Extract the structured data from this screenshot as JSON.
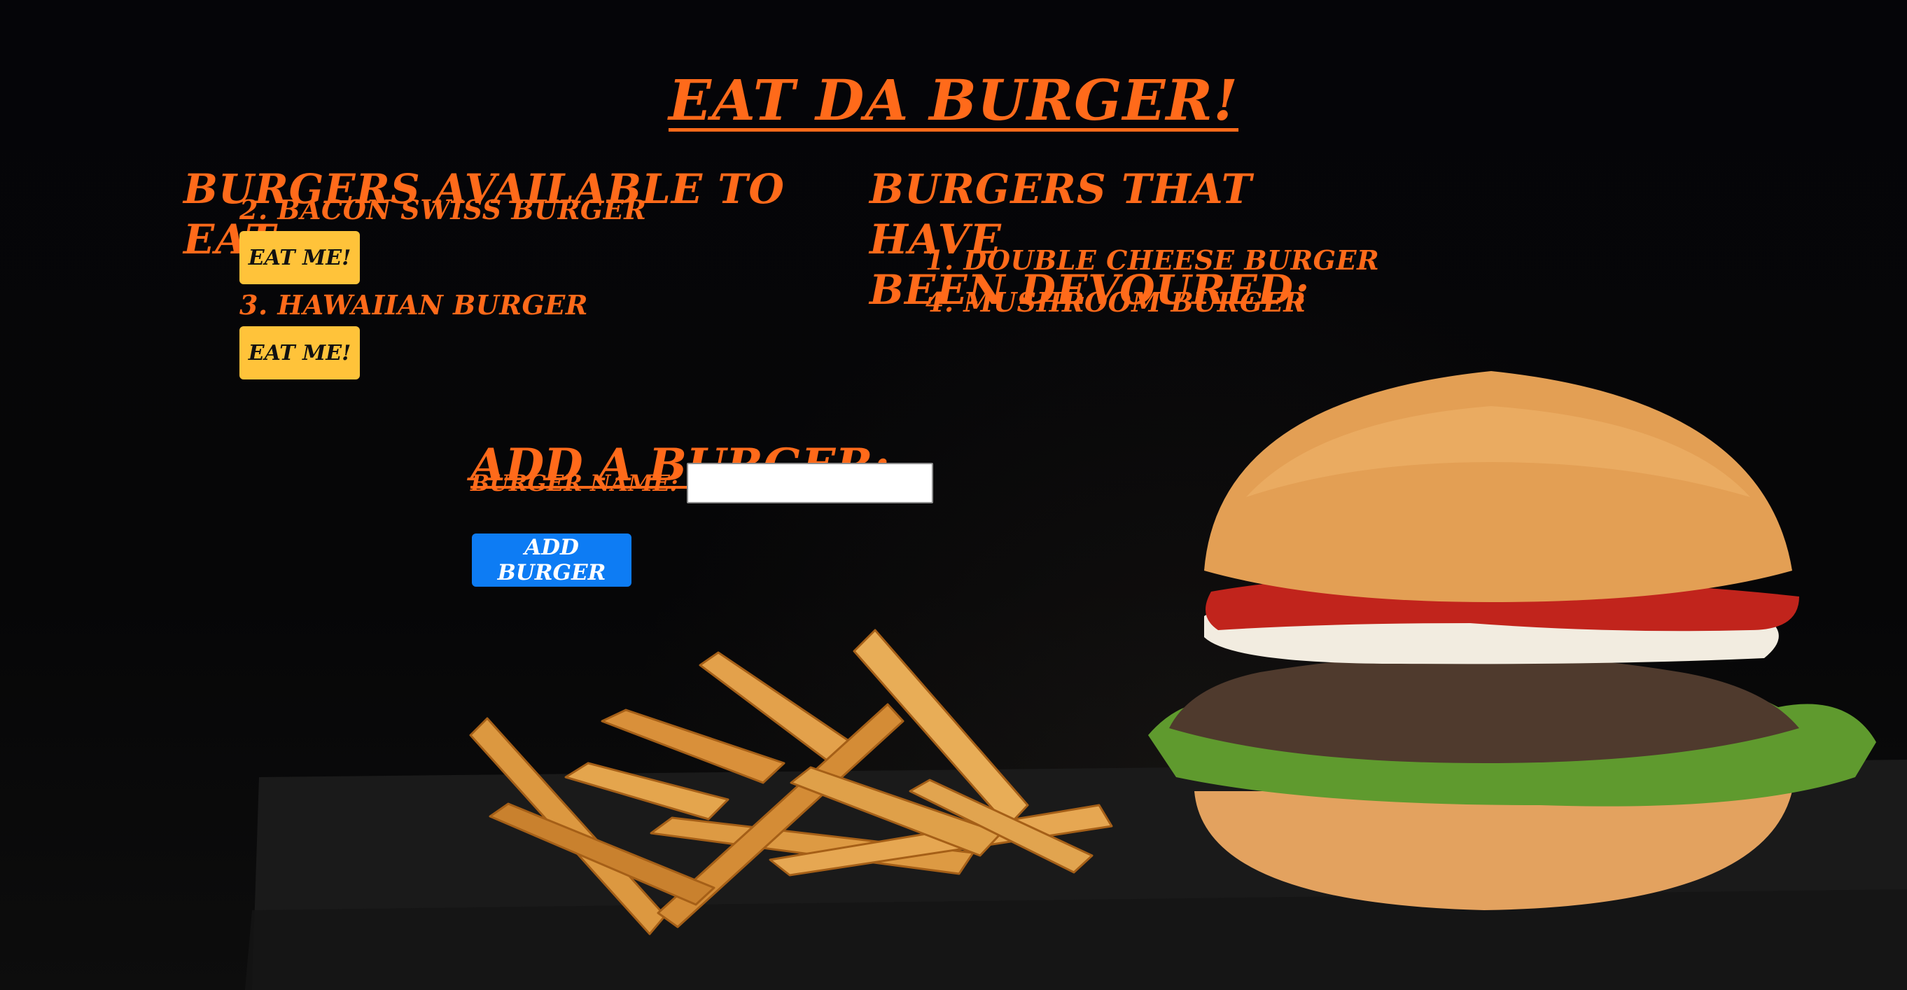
{
  "page": {
    "title": "Eat Da Burger!"
  },
  "available": {
    "title": "Burgers Available to Eat:",
    "items": [
      {
        "label": "2. Bacon Swiss Burger",
        "button_label": "Eat Me!"
      },
      {
        "label": "3. Hawaiian Burger",
        "button_label": "Eat Me!"
      }
    ]
  },
  "devoured": {
    "title_line_1": "Burgers That Have",
    "title_line_2": "Been Devoured:",
    "items": [
      {
        "label": "1. Double Cheese Burger"
      },
      {
        "label": "4. Mushroom Burger"
      }
    ]
  },
  "add_form": {
    "title": "Add a Burger:",
    "label": "Burger Name:",
    "input_value": "",
    "submit_label": "Add Burger"
  },
  "colors": {
    "accent": "#ff6a1a",
    "eat_button": "#ffc33a",
    "add_button": "#0d7cf4",
    "background": "#050506"
  }
}
